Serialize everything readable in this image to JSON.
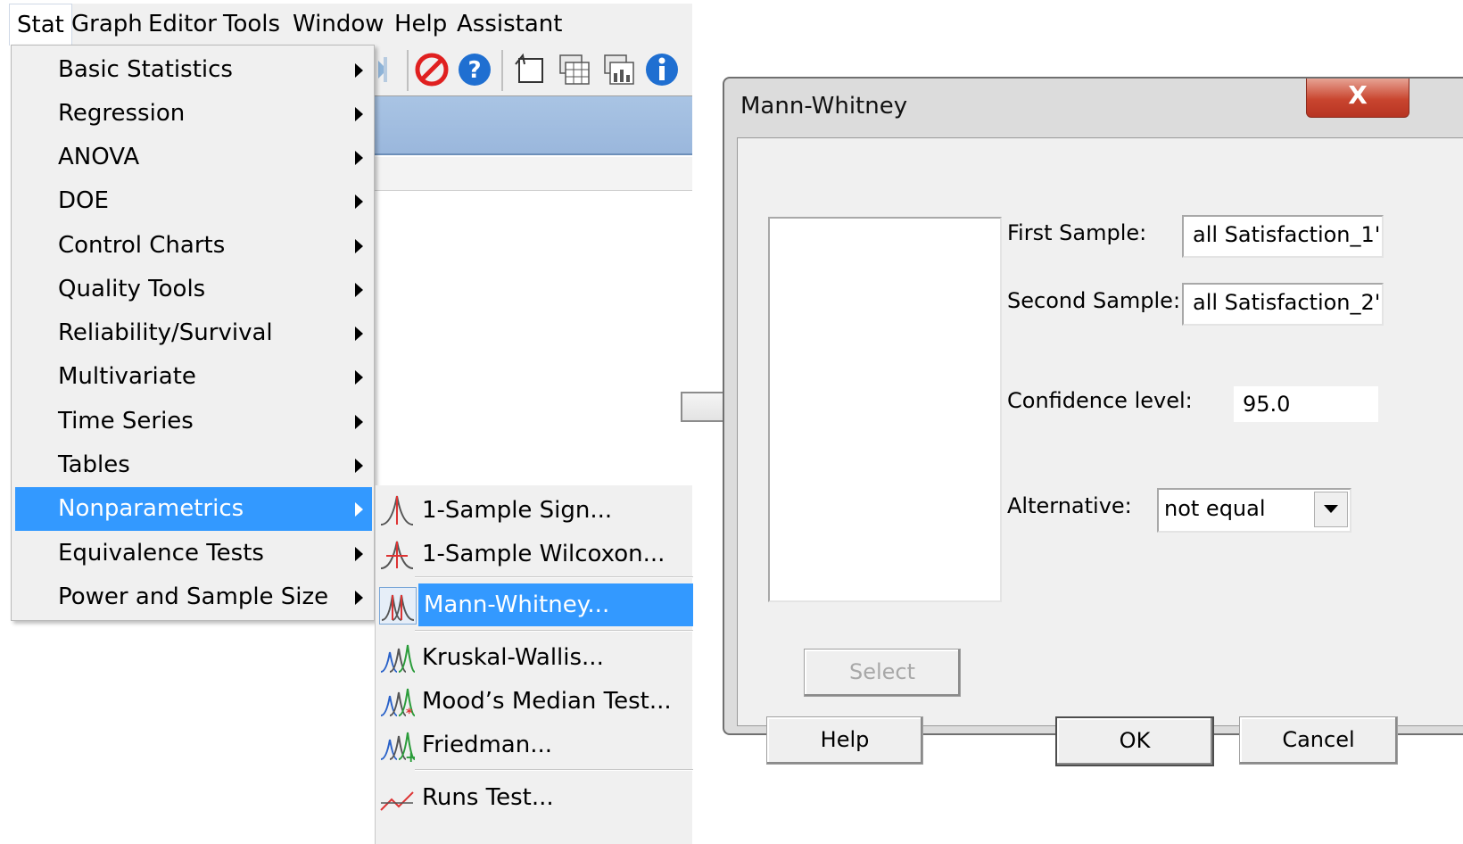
{
  "menubar": {
    "items": [
      "Stat",
      "Graph",
      "Editor",
      "Tools",
      "Window",
      "Help",
      "Assistant"
    ]
  },
  "stat_menu": {
    "items": [
      {
        "label": "Basic Statistics",
        "has_submenu": true
      },
      {
        "label": "Regression",
        "has_submenu": true
      },
      {
        "label": "ANOVA",
        "has_submenu": true
      },
      {
        "label": "DOE",
        "has_submenu": true
      },
      {
        "label": "Control Charts",
        "has_submenu": true
      },
      {
        "label": "Quality Tools",
        "has_submenu": true
      },
      {
        "label": "Reliability/Survival",
        "has_submenu": true
      },
      {
        "label": "Multivariate",
        "has_submenu": true
      },
      {
        "label": "Time Series",
        "has_submenu": true
      },
      {
        "label": "Tables",
        "has_submenu": true
      },
      {
        "label": "Nonparametrics",
        "has_submenu": true,
        "highlighted": true
      },
      {
        "label": "Equivalence Tests",
        "has_submenu": true
      },
      {
        "label": "Power and Sample Size",
        "has_submenu": true
      }
    ]
  },
  "nonparametrics_submenu": {
    "items": [
      {
        "label": "1-Sample Sign...",
        "icon": "sign-test-icon"
      },
      {
        "label": "1-Sample Wilcoxon...",
        "icon": "wilcoxon-icon"
      },
      {
        "label": "Mann-Whitney...",
        "icon": "mann-whitney-icon",
        "highlighted": true
      },
      {
        "label": "Kruskal-Wallis...",
        "icon": "kruskal-wallis-icon"
      },
      {
        "label": "Mood’s Median Test...",
        "icon": "moods-median-icon"
      },
      {
        "label": "Friedman...",
        "icon": "friedman-icon"
      },
      {
        "label": "Runs Test...",
        "icon": "runs-test-icon"
      }
    ]
  },
  "toolbar": {
    "icons": [
      "cancel-icon",
      "help-icon",
      "scroll-icon",
      "worksheet-icon",
      "worksheet-graph-icon",
      "info-icon"
    ]
  },
  "dialog": {
    "title": "Mann-Whitney",
    "close_label": "X",
    "first_sample_label": "First Sample:",
    "first_sample_value": "all Satisfaction_1'",
    "second_sample_label": "Second Sample:",
    "second_sample_value": "all Satisfaction_2'",
    "confidence_label": "Confidence level:",
    "confidence_value": "95.0",
    "alternative_label": "Alternative:",
    "alternative_value": "not equal",
    "select_label": "Select",
    "help_label": "Help",
    "ok_label": "OK",
    "cancel_label": "Cancel"
  },
  "colors": {
    "highlight": "#3399ff",
    "menu_bg": "#f0f0f0",
    "close_button": "#c9452f"
  }
}
